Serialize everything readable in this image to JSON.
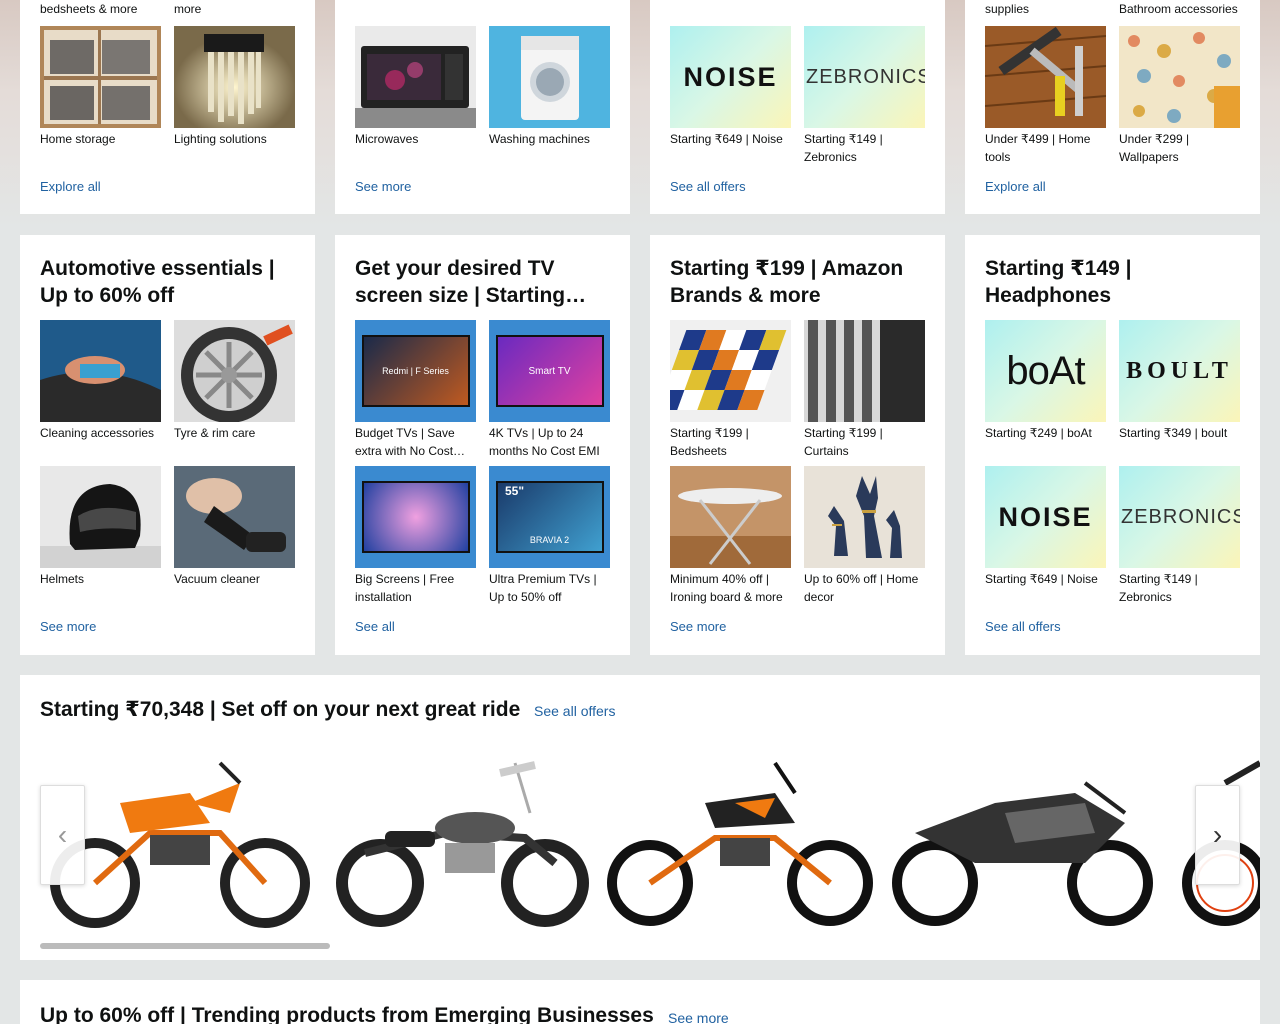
{
  "colors": {
    "link": "#2162a1",
    "page_bg": "#e3e6e6",
    "card_bg": "#ffffff"
  },
  "top_cards": [
    {
      "top_captions": [
        "bedsheets & more",
        "more"
      ],
      "tiles": [
        {
          "caption": "Home storage",
          "icon": "shelf-baskets-image"
        },
        {
          "caption": "Lighting solutions",
          "icon": "wall-lamp-image"
        }
      ],
      "link": "Explore all"
    },
    {
      "top_captions": [
        "",
        ""
      ],
      "tiles": [
        {
          "caption": "Microwaves",
          "icon": "microwave-image"
        },
        {
          "caption": "Washing machines",
          "icon": "washing-machine-image"
        }
      ],
      "link": "See more"
    },
    {
      "top_captions": [
        "",
        ""
      ],
      "tiles": [
        {
          "caption": "Starting ₹649 | Noise",
          "brand": "NOISE"
        },
        {
          "caption": "Starting ₹149 | Zebronics",
          "brand": "ZEBRONICS"
        }
      ],
      "link": "See all offers"
    },
    {
      "top_captions": [
        "supplies",
        "Bathroom accessories"
      ],
      "tiles": [
        {
          "caption": "Under ₹499 | Home tools",
          "icon": "hand-tools-image"
        },
        {
          "caption": "Under ₹299 | Wallpapers",
          "icon": "floral-wallpaper-image"
        }
      ],
      "link": "Explore all"
    }
  ],
  "mid_cards": [
    {
      "title": "Automotive essentials | Up to 60% off",
      "tiles": [
        {
          "caption": "Cleaning accessories",
          "icon": "car-cleaning-image"
        },
        {
          "caption": "Tyre & rim care",
          "icon": "rim-wash-image"
        },
        {
          "caption": "Helmets",
          "icon": "helmet-image"
        },
        {
          "caption": "Vacuum cleaner",
          "icon": "car-vacuum-image"
        }
      ],
      "link": "See more"
    },
    {
      "title": "Get your desired TV screen size | Starting…",
      "tiles": [
        {
          "caption": "Budget TVs | Save extra with No Cost…",
          "screen_text": "Redmi | F Series"
        },
        {
          "caption": "4K TVs | Up to 24 months No Cost EMI",
          "screen_text": "Smart TV"
        },
        {
          "caption": "Big Screens | Free installation",
          "screen_text": ""
        },
        {
          "caption": "Ultra Premium TVs | Up to 50% off",
          "screen_text": "BRAVIA 2",
          "badge": "55\""
        }
      ],
      "link": "See all"
    },
    {
      "title": "Starting ₹199 | Amazon Brands & more",
      "tiles": [
        {
          "caption": "Starting ₹199 | Bedsheets",
          "icon": "bedsheet-image"
        },
        {
          "caption": "Starting ₹199 | Curtains",
          "icon": "curtains-image"
        },
        {
          "caption": "Minimum 40% off | Ironing board & more",
          "icon": "ironing-board-image"
        },
        {
          "caption": "Up to 60% off | Home decor",
          "icon": "deer-decor-image"
        }
      ],
      "link": "See more"
    },
    {
      "title": "Starting ₹149 | Headphones",
      "tiles": [
        {
          "caption": "Starting ₹249 | boAt",
          "brand": "boAt"
        },
        {
          "caption": "Starting ₹349 | boult",
          "brand": "BOULT"
        },
        {
          "caption": "Starting ₹649 | Noise",
          "brand": "NOISE"
        },
        {
          "caption": "Starting ₹149 | Zebronics",
          "brand": "ZEBRONICS"
        }
      ],
      "link": "See all offers"
    }
  ],
  "ride": {
    "title": "Starting ₹70,348 | Set off on your next great ride",
    "link": "See all offers",
    "bikes": [
      "adventure-bike-image",
      "cruiser-bike-image",
      "naked-bike-image",
      "sport-bike-image"
    ],
    "prev_icon": "‹",
    "next_icon": "›"
  },
  "bottom": {
    "title": "Up to 60% off | Trending products from Emerging Businesses",
    "link": "See more"
  }
}
